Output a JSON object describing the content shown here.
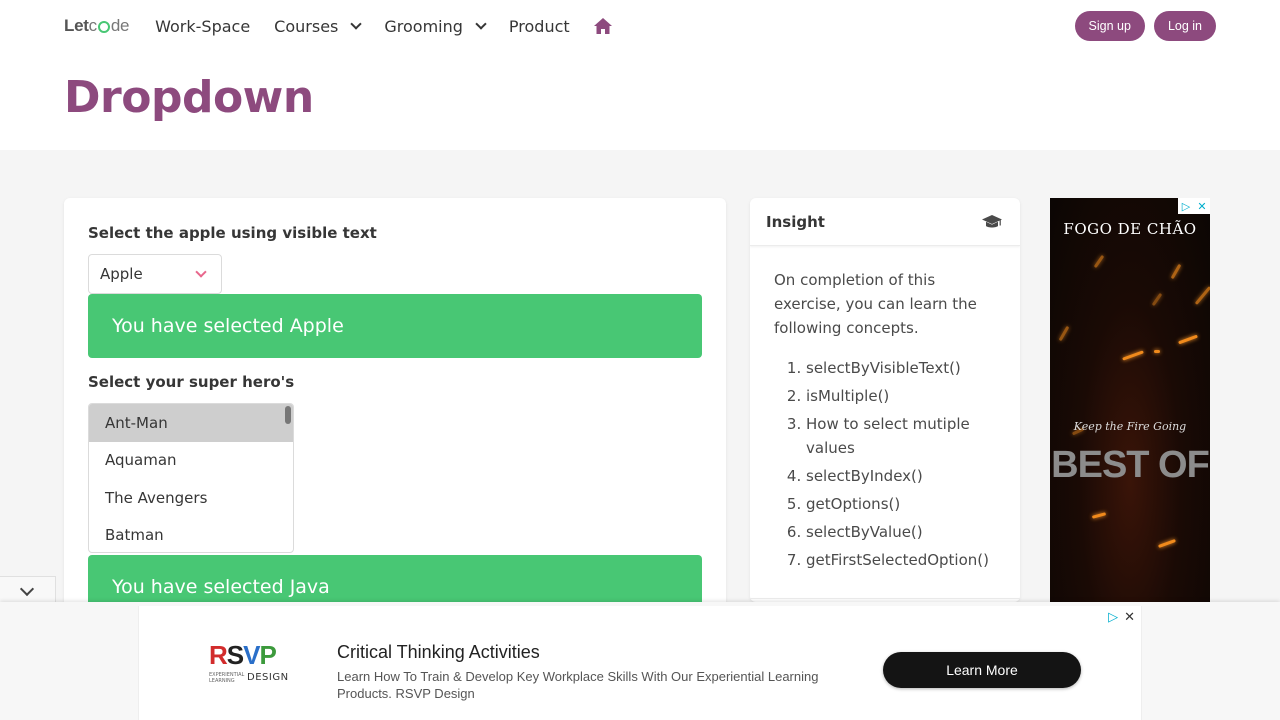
{
  "header": {
    "logo_prefix": "Let",
    "logo_suffix": "de",
    "nav": [
      "Work-Space",
      "Courses",
      "Grooming",
      "Product"
    ],
    "signup": "Sign up",
    "login": "Log in"
  },
  "page_title": "Dropdown",
  "main": {
    "fruit_label": "Select the apple using visible text",
    "fruit_value": "Apple",
    "fruit_notice": "You have selected Apple",
    "hero_label": "Select your super hero's",
    "heroes": [
      "Ant-Man",
      "Aquaman",
      "The Avengers",
      "Batman"
    ],
    "lang_notice": "You have selected Java"
  },
  "insight": {
    "title": "Insight",
    "intro": "On completion of this exercise, you can learn the following concepts.",
    "items": [
      "selectByVisibleText()",
      "isMultiple()",
      "How to select mutiple values",
      "selectByIndex()",
      "getOptions()",
      "selectByValue()",
      "getFirstSelectedOption()"
    ]
  },
  "side_ad": {
    "brand": "FOGO DE CHÃO",
    "tagline": "Keep the Fire Going",
    "headline": "BEST OF"
  },
  "bottom_ad": {
    "logo_text": "RSVP",
    "logo_sub": "EXPERIENTIAL LEARNING",
    "logo_design": "DESIGN",
    "title": "Critical Thinking Activities",
    "description": "Learn How To Train & Develop Key Workplace Skills With Our Experiential Learning Products. RSVP Design",
    "cta": "Learn More"
  },
  "colors": {
    "brand": "#8d4a7e",
    "success": "#48c774",
    "chevron_accent": "#e8678c"
  }
}
